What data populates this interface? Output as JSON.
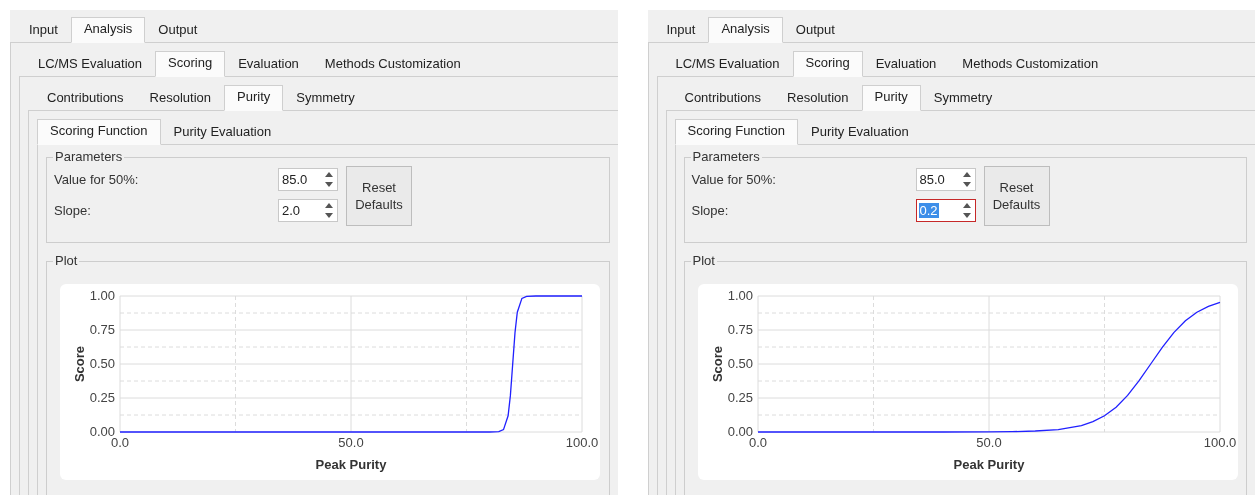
{
  "panels": [
    {
      "main_tabs": [
        {
          "label": "Input",
          "selected": false
        },
        {
          "label": "Analysis",
          "selected": true
        },
        {
          "label": "Output",
          "selected": false
        }
      ],
      "analysis_tabs": [
        {
          "label": "LC/MS Evaluation",
          "selected": false
        },
        {
          "label": "Scoring",
          "selected": true
        },
        {
          "label": "Evaluation",
          "selected": false
        },
        {
          "label": "Methods Customization",
          "selected": false
        }
      ],
      "scoring_tabs": [
        {
          "label": "Contributions",
          "selected": false
        },
        {
          "label": "Resolution",
          "selected": false
        },
        {
          "label": "Purity",
          "selected": true
        },
        {
          "label": "Symmetry",
          "selected": false
        }
      ],
      "purity_tabs": [
        {
          "label": "Scoring Function",
          "selected": true
        },
        {
          "label": "Purity Evaluation",
          "selected": false
        }
      ],
      "parameters": {
        "title": "Parameters",
        "fields": [
          {
            "label": "Value for 50%:",
            "value": "85.0",
            "focused": false
          },
          {
            "label": "Slope:",
            "value": "2.0",
            "focused": false
          }
        ],
        "button": "Reset Defaults"
      },
      "plot": {
        "title": "Plot",
        "chart_data": {
          "type": "line",
          "xlabel": "Peak Purity",
          "ylabel": "Score",
          "x": [
            0,
            10,
            20,
            30,
            40,
            50,
            60,
            70,
            75,
            80,
            82,
            83,
            84,
            84.5,
            85,
            85.5,
            86,
            87,
            88,
            90,
            95,
            100
          ],
          "grid": true,
          "series": [
            {
              "color": "#2020ff",
              "values": [
                0,
                0,
                0,
                0,
                0,
                0,
                0,
                0,
                0,
                0,
                0.002,
                0.018,
                0.119,
                0.269,
                0.5,
                0.731,
                0.881,
                0.982,
                0.998,
                1,
                1,
                1
              ]
            }
          ],
          "xlim": [
            0,
            100
          ],
          "ylim": [
            0,
            1
          ],
          "xticks": [
            {
              "value": 0,
              "label": "0.0"
            },
            {
              "value": 50,
              "label": "50.0"
            },
            {
              "value": 100,
              "label": "100.0"
            }
          ],
          "yticks": [
            {
              "value": 0,
              "label": "0.00"
            },
            {
              "value": 0.25,
              "label": "0.25"
            },
            {
              "value": 0.5,
              "label": "0.50"
            },
            {
              "value": 0.75,
              "label": "0.75"
            },
            {
              "value": 1,
              "label": "1.00"
            }
          ]
        }
      }
    },
    {
      "main_tabs": [
        {
          "label": "Input",
          "selected": false
        },
        {
          "label": "Analysis",
          "selected": true
        },
        {
          "label": "Output",
          "selected": false
        }
      ],
      "analysis_tabs": [
        {
          "label": "LC/MS Evaluation",
          "selected": false
        },
        {
          "label": "Scoring",
          "selected": true
        },
        {
          "label": "Evaluation",
          "selected": false
        },
        {
          "label": "Methods Customization",
          "selected": false
        }
      ],
      "scoring_tabs": [
        {
          "label": "Contributions",
          "selected": false
        },
        {
          "label": "Resolution",
          "selected": false
        },
        {
          "label": "Purity",
          "selected": true
        },
        {
          "label": "Symmetry",
          "selected": false
        }
      ],
      "purity_tabs": [
        {
          "label": "Scoring Function",
          "selected": true
        },
        {
          "label": "Purity Evaluation",
          "selected": false
        }
      ],
      "parameters": {
        "title": "Parameters",
        "fields": [
          {
            "label": "Value for 50%:",
            "value": "85.0",
            "focused": false
          },
          {
            "label": "Slope:",
            "value": "0.2",
            "focused": true
          }
        ],
        "button": "Reset Defaults"
      },
      "plot": {
        "title": "Plot",
        "chart_data": {
          "type": "line",
          "xlabel": "Peak Purity",
          "ylabel": "Score",
          "x": [
            0,
            10,
            20,
            30,
            40,
            50,
            55,
            60,
            65,
            70,
            72.5,
            75,
            77.5,
            80,
            82.5,
            85,
            87.5,
            90,
            92.5,
            95,
            97.5,
            100
          ],
          "grid": true,
          "series": [
            {
              "color": "#2020ff",
              "values": [
                0,
                0,
                0,
                0,
                0,
                0.001,
                0.002,
                0.007,
                0.018,
                0.047,
                0.076,
                0.119,
                0.182,
                0.269,
                0.378,
                0.5,
                0.622,
                0.731,
                0.818,
                0.881,
                0.924,
                0.953
              ]
            }
          ],
          "xlim": [
            0,
            100
          ],
          "ylim": [
            0,
            1
          ],
          "xticks": [
            {
              "value": 0,
              "label": "0.0"
            },
            {
              "value": 50,
              "label": "50.0"
            },
            {
              "value": 100,
              "label": "100.0"
            }
          ],
          "yticks": [
            {
              "value": 0,
              "label": "0.00"
            },
            {
              "value": 0.25,
              "label": "0.25"
            },
            {
              "value": 0.5,
              "label": "0.50"
            },
            {
              "value": 0.75,
              "label": "0.75"
            },
            {
              "value": 1,
              "label": "1.00"
            }
          ]
        }
      }
    }
  ]
}
